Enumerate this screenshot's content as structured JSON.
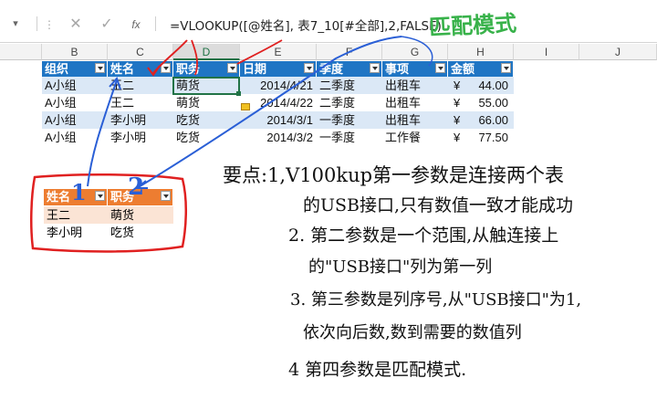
{
  "formula_bar": {
    "fx_label": "fx",
    "formula": "=VLOOKUP([@姓名], 表7_10[#全部],2,FALSE)",
    "match_mode_note": "匹配模式"
  },
  "columns": [
    "B",
    "C",
    "D",
    "E",
    "F",
    "G",
    "H",
    "I",
    "J"
  ],
  "main_table": {
    "headers": [
      "组织",
      "姓名",
      "职务",
      "日期",
      "季度",
      "事项",
      "金额"
    ],
    "rows": [
      {
        "org": "A小组",
        "name": "王二",
        "title": "萌货",
        "date": "2014/4/21",
        "quarter": "二季度",
        "item": "出租车",
        "cur": "¥",
        "amount": "44.00"
      },
      {
        "org": "A小组",
        "name": "王二",
        "title": "萌货",
        "date": "2014/4/22",
        "quarter": "二季度",
        "item": "出租车",
        "cur": "¥",
        "amount": "55.00"
      },
      {
        "org": "A小组",
        "name": "李小明",
        "title": "吃货",
        "date": "2014/3/1",
        "quarter": "一季度",
        "item": "出租车",
        "cur": "¥",
        "amount": "66.00"
      },
      {
        "org": "A小组",
        "name": "李小明",
        "title": "吃货",
        "date": "2014/3/2",
        "quarter": "一季度",
        "item": "工作餐",
        "cur": "¥",
        "amount": "77.50"
      }
    ]
  },
  "lookup_table": {
    "headers": [
      "姓名",
      "职务"
    ],
    "rows": [
      {
        "name": "王二",
        "title": "萌货"
      },
      {
        "name": "李小明",
        "title": "吃货"
      }
    ]
  },
  "annotations": {
    "num1": "1",
    "num2": "2",
    "points": [
      "要点:1,V100kup第一参数是连接两个表",
      "的USB接口,只有数值一致才能成功",
      "2. 第二参数是一个范围,从触连接上",
      "的\"USB接口\"列为第一列",
      "3. 第三参数是列序号,从\"USB接口\"为1,",
      "依次向后数,数到需要的数值列",
      "4 第四参数是匹配模式."
    ]
  },
  "colors": {
    "table_header": "#1f75c4",
    "lookup_header": "#ed7d31",
    "annotation_red": "#e02020",
    "annotation_blue": "#2a5fd6",
    "note_green": "#38b24a"
  }
}
